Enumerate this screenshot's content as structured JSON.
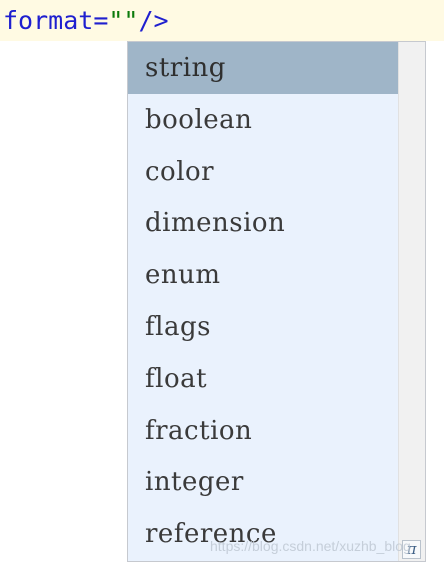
{
  "code": {
    "attr": "format",
    "eq": "=",
    "value": "\"\"",
    "tag_close": "/>"
  },
  "completion": {
    "items": [
      "string",
      "boolean",
      "color",
      "dimension",
      "enum",
      "flags",
      "float",
      "fraction",
      "integer",
      "reference"
    ],
    "selected_index": 0,
    "footer_icon": "π"
  },
  "watermark": "https://blog.csdn.net/xuzhb_blog",
  "colors": {
    "code_background": "#fffae3",
    "popup_background": "#eaf2fd",
    "selected_background": "#9fb5c8",
    "attribute": "#1f1fcf",
    "value": "#0b7a0b"
  },
  "icons": {
    "footer": "pi-icon"
  }
}
